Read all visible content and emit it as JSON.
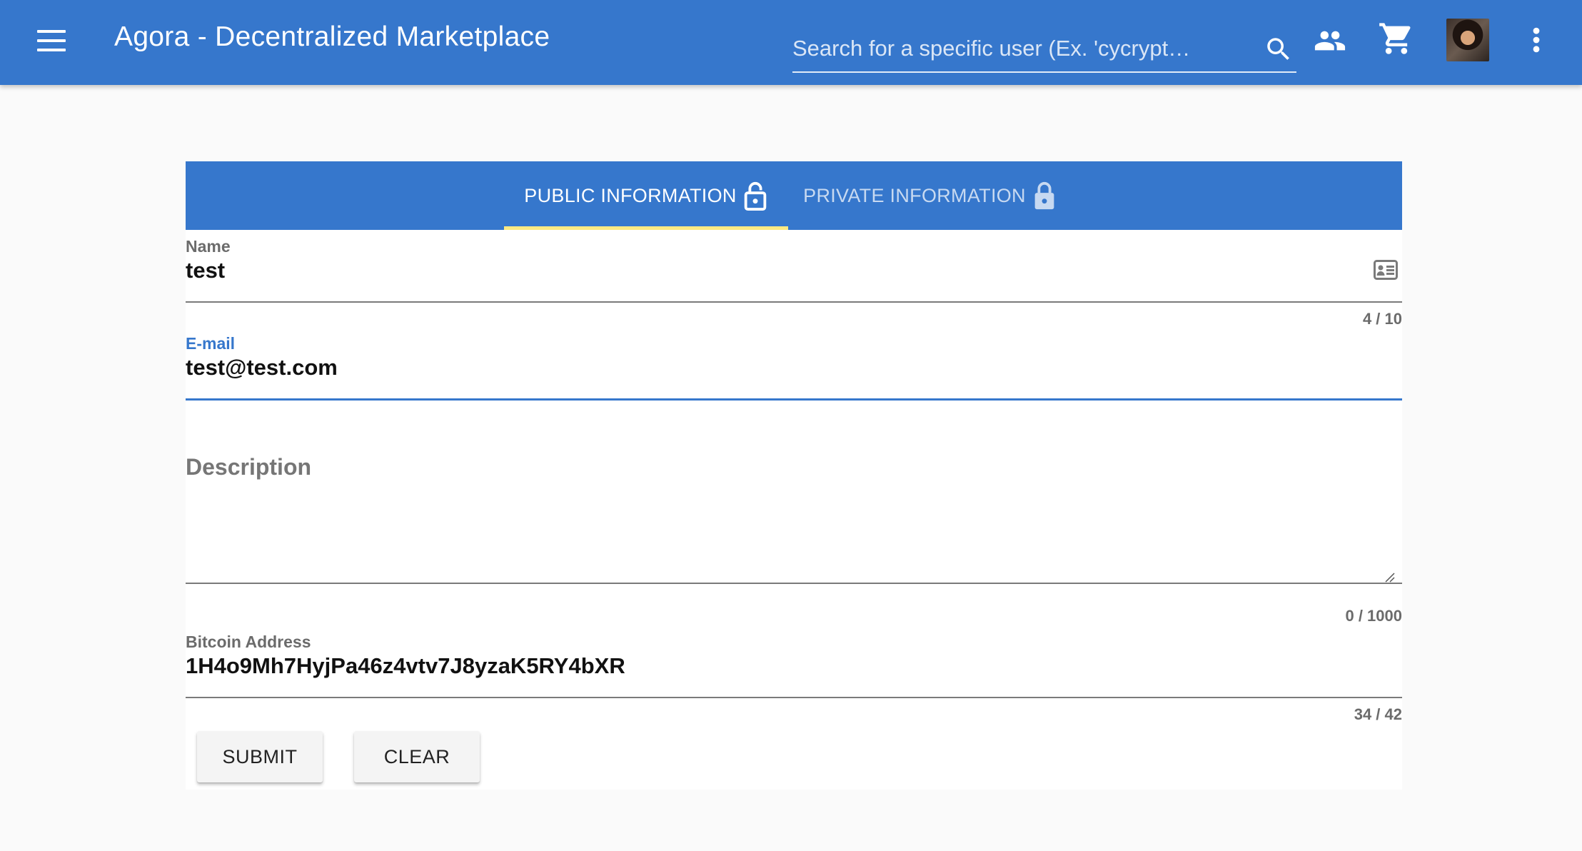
{
  "appbar": {
    "title": "Agora - Decentralized Marketplace",
    "search_placeholder": "Search for a specific user (Ex. 'cycrypt…",
    "icons": [
      "menu-icon",
      "search-icon",
      "people-icon",
      "cart-icon",
      "avatar",
      "more-vert-icon"
    ]
  },
  "tabs": {
    "public_label": "PUBLIC INFORMATION",
    "public_icon": "lock-open-icon",
    "private_label": "PRIVATE INFORMATION",
    "private_icon": "lock-icon",
    "indicator_color": "#fde982"
  },
  "form": {
    "name": {
      "label": "Name",
      "value": "test",
      "counter": "4 / 10",
      "icon": "contact-card-icon"
    },
    "email": {
      "label": "E-mail",
      "value": "test@test.com"
    },
    "description": {
      "label": "Description",
      "value": "",
      "counter": "0 / 1000"
    },
    "bitcoin": {
      "label": "Bitcoin Address",
      "value": "1H4o9Mh7HyjPa46z4vtv7J8yzaK5RY4bXR",
      "counter": "34 / 42"
    }
  },
  "buttons": {
    "submit": "SUBMIT",
    "clear": "CLEAR"
  },
  "colors": {
    "primary": "#3677cc",
    "background": "#fafafa"
  }
}
